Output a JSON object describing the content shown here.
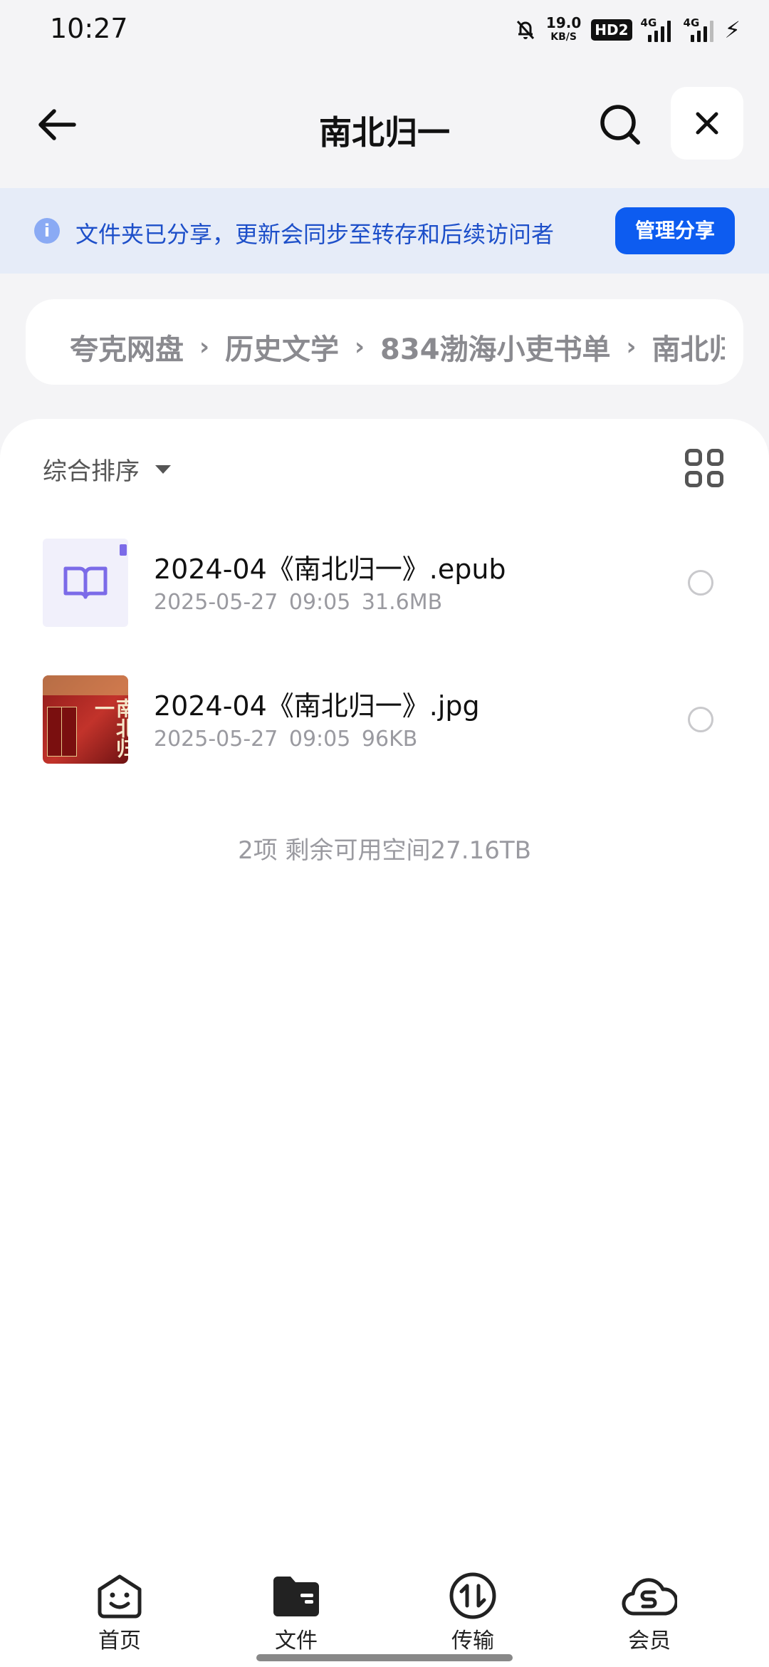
{
  "status_bar": {
    "time": "10:27",
    "net_speed": "19.0",
    "net_unit": "KB/S",
    "hd_badge": "HD2",
    "sig1_label": "4G",
    "sig2_label": "4G"
  },
  "header": {
    "title": "南北归一"
  },
  "share_banner": {
    "text": "文件夹已分享，更新会同步至转存和后续访问者",
    "manage_label": "管理分享"
  },
  "breadcrumb": [
    "夸克网盘",
    "历史文学",
    "834渤海小吏书单",
    "南北归一"
  ],
  "sort": {
    "label": "综合排序"
  },
  "files": [
    {
      "name": "2024-04《南北归一》.epub",
      "date": "2025-05-27 09:05",
      "size": "31.6MB",
      "type": "epub"
    },
    {
      "name": "2024-04《南北归一》.jpg",
      "date": "2025-05-27 09:05",
      "size": "96KB",
      "type": "jpg",
      "cover_text": "南北归一"
    }
  ],
  "summary": "2项 剩余可用空间27.16TB",
  "nav": {
    "home": "首页",
    "files": "文件",
    "transfer": "传输",
    "member": "会员"
  },
  "colors": {
    "accent": "#0d5cf0",
    "banner_bg": "#e6ecf8",
    "banner_text": "#1d4fc9"
  }
}
